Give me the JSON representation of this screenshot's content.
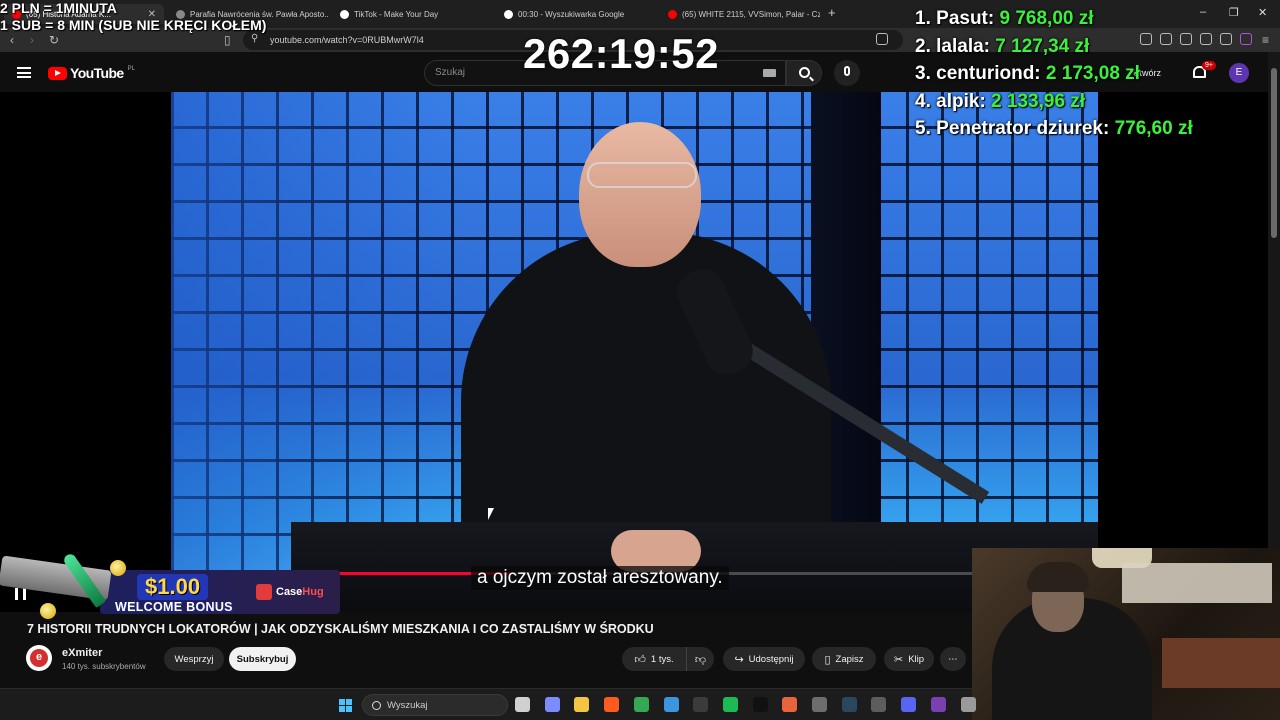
{
  "browser": {
    "tabs": [
      {
        "label": "(65) Historia Adama K...",
        "active": true,
        "favicon_color": "#ff0000"
      },
      {
        "label": "Parafia Nawrócenia św. Pawła Aposto...",
        "active": false,
        "favicon_color": "#888888"
      },
      {
        "label": "TikTok - Make Your Day",
        "active": false,
        "favicon_color": "#ffffff"
      },
      {
        "label": "00:30 - Wyszukiwarka Google",
        "active": false,
        "favicon_color": "#ffffff"
      },
      {
        "label": "(65) WHITE 2115, VVSimon, Palar - Cz...",
        "active": false,
        "favicon_color": "#ff0000"
      }
    ],
    "new_tab_symbol": "+",
    "window_controls": [
      "–",
      "❐",
      "✕"
    ],
    "url": "youtube.com/watch?v=0RUBMwrW7l4"
  },
  "youtube": {
    "logo_text": "YouTube",
    "region": "PL",
    "search_placeholder": "Szukaj",
    "create_label": "Utwórz",
    "notifications_badge": "9+",
    "avatar_letter": "E"
  },
  "overlay": {
    "donation_rule_1": "2 PLN = 1MINUTA",
    "donation_rule_2": "1 SUB = 8 MIN (SUB NIE KRĘCI KOŁEM)",
    "timer": "262:19:52",
    "leaderboard": [
      {
        "rank": "1.",
        "name": "Pasut:",
        "amount": "9 768,00 zł"
      },
      {
        "rank": "2.",
        "name": "lalala:",
        "amount": "7 127,34 zł"
      },
      {
        "rank": "3.",
        "name": "centuriond:",
        "amount": "2 173,08 zł"
      },
      {
        "rank": "4.",
        "name": "alpik:",
        "amount": "2 133,96 zł"
      },
      {
        "rank": "5.",
        "name": "Penetrator dziurek:",
        "amount": "776,60 zł"
      }
    ],
    "promo": {
      "amount": "$1.00",
      "bonus": "WELCOME BONUS",
      "brand_a": "Case",
      "brand_b": "Hug"
    }
  },
  "video": {
    "subtitle": "a ojczym został aresztowany.",
    "progress_fraction": 0.52,
    "title": "7 HISTORII TRUDNYCH LOKATORÓW | JAK ODZYSKALIŚMY MIESZKANIA I CO ZASTALIŚMY W ŚRODKU",
    "channel_name": "eXmiter",
    "subscribers": "140 tys. subskrybentów",
    "support_label": "Wesprzyj",
    "subscribe_label": "Subskrybuj",
    "likes": "1 tys.",
    "share_label": "Udostępnij",
    "save_label": "Zapisz",
    "clip_label": "Klip",
    "more_symbol": "⋯"
  },
  "taskbar": {
    "search_placeholder": "Wyszukaj",
    "apps": [
      {
        "name": "task-view",
        "color": "#d0d0d0"
      },
      {
        "name": "copilot",
        "color": "#7b8cff"
      },
      {
        "name": "file-explorer",
        "color": "#f4c542"
      },
      {
        "name": "brave",
        "color": "#ff5a1f"
      },
      {
        "name": "chrome",
        "color": "#34a853"
      },
      {
        "name": "store",
        "color": "#3a96dd"
      },
      {
        "name": "app-dark",
        "color": "#3b3b3b"
      },
      {
        "name": "spotify",
        "color": "#1db954"
      },
      {
        "name": "app-black",
        "color": "#111111"
      },
      {
        "name": "app-orange",
        "color": "#e8643c"
      },
      {
        "name": "app-gray",
        "color": "#6d6d6d"
      },
      {
        "name": "steam",
        "color": "#2a475e"
      },
      {
        "name": "calculator",
        "color": "#5d5d5d"
      },
      {
        "name": "discord",
        "color": "#5865f2"
      },
      {
        "name": "app-purple",
        "color": "#7a3fb0"
      },
      {
        "name": "settings",
        "color": "#9a9a9a"
      }
    ]
  }
}
